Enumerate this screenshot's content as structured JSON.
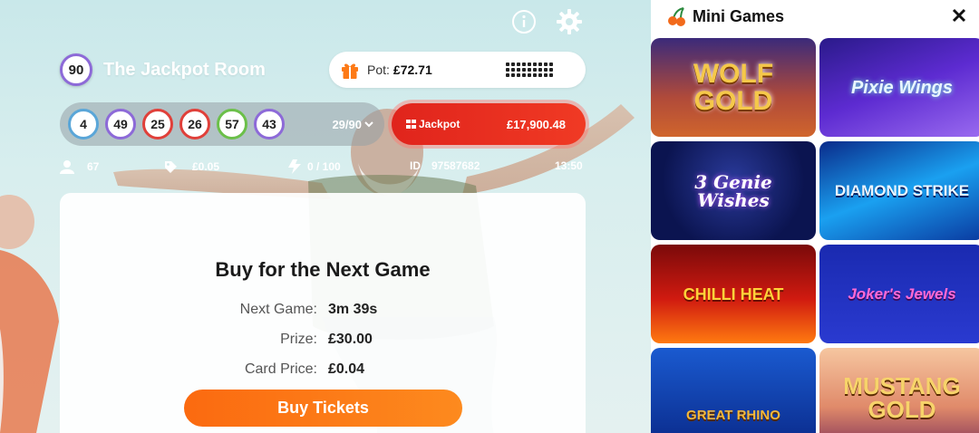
{
  "room": {
    "ball_number": "90",
    "name": "The Jackpot Room",
    "pot_label": "Pot:",
    "pot_value": "£72.71",
    "called_balls": [
      "4",
      "49",
      "25",
      "26",
      "57",
      "43"
    ],
    "called_count": "29/90",
    "jackpot_label": "Jackpot",
    "jackpot_value": "£17,900.48",
    "stats": {
      "players": "67",
      "card_price": "£0.05",
      "tickets": "0 / 100",
      "id_label": "ID",
      "id_value": "97587682",
      "time": "13:50"
    }
  },
  "panel": {
    "title": "Buy for the Next Game",
    "rows": [
      {
        "label": "Next Game:",
        "value": "3m 39s"
      },
      {
        "label": "Prize:",
        "value": "£30.00"
      },
      {
        "label": "Card Price:",
        "value": "£0.04"
      }
    ],
    "buy_label": "Buy Tickets"
  },
  "mini_games": {
    "title": "Mini Games",
    "games": [
      {
        "name": "WOLF GOLD"
      },
      {
        "name": "Pixie Wings"
      },
      {
        "name": "3 Genie Wishes"
      },
      {
        "name": "DIAMOND STRIKE"
      },
      {
        "name": "CHILLI HEAT"
      },
      {
        "name": "Joker's Jewels"
      },
      {
        "name": "GREAT RHINO"
      },
      {
        "name": "MUSTANG GOLD"
      }
    ]
  },
  "colors": {
    "accent_orange": "#fd7a17",
    "jackpot_red": "#e52a1e",
    "ball_purple": "#8d6ad8"
  }
}
